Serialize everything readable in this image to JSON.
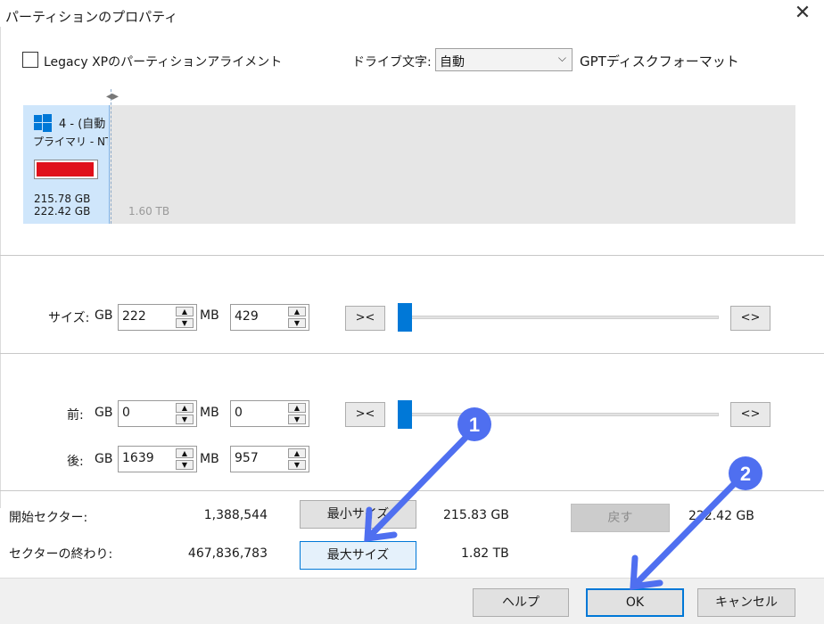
{
  "window": {
    "title": "パーティションのプロパティ",
    "close_glyph": "✕"
  },
  "options": {
    "legacy_xp_label": "Legacy XPのパーティションアライメント",
    "legacy_xp_checked": false,
    "drive_letter_label": "ドライブ文字:",
    "drive_letter_value": "自動",
    "gpt_label": "GPTディスクフォーマット"
  },
  "partition": {
    "name": "4 - (自動",
    "type": "プライマリ - NT",
    "used": "215.78 GB",
    "total": "222.42 GB",
    "usage_fraction": 0.97,
    "usage_color": "#e0101a",
    "free_space": "1.60 TB"
  },
  "size": {
    "label": "サイズ:",
    "gb_unit": "GB",
    "mb_unit": "MB",
    "gb_value": "222",
    "mb_value": "429",
    "shrink_label": "><",
    "expand_label": "<>"
  },
  "position": {
    "before_label": "前:",
    "after_label": "後:",
    "gb_unit": "GB",
    "mb_unit": "MB",
    "before_gb": "0",
    "before_mb": "0",
    "after_gb": "1639",
    "after_mb": "957",
    "shrink_label": "><",
    "expand_label": "<>"
  },
  "info": {
    "start_sector_label": "開始セクター:",
    "start_sector_value": "1,388,544",
    "end_sector_label": "セクターの終わり:",
    "end_sector_value": "467,836,783",
    "min_size_button": "最小サイズ",
    "max_size_button": "最大サイズ",
    "min_size_value": "215.83 GB",
    "max_size_value": "1.82 TB",
    "revert_button": "戻す",
    "revert_value": "222.42 GB"
  },
  "footer": {
    "help_button": "ヘルプ",
    "ok_button": "OK",
    "cancel_button": "キャンセル"
  },
  "annotations": {
    "step1": "1",
    "step2": "2",
    "color": "#4f6ff0"
  },
  "icons": {
    "windows": "windows-logo-icon",
    "dropdown": "chevron-down-icon",
    "spin_up": "up-arrow-icon",
    "spin_down": "down-arrow-icon"
  }
}
